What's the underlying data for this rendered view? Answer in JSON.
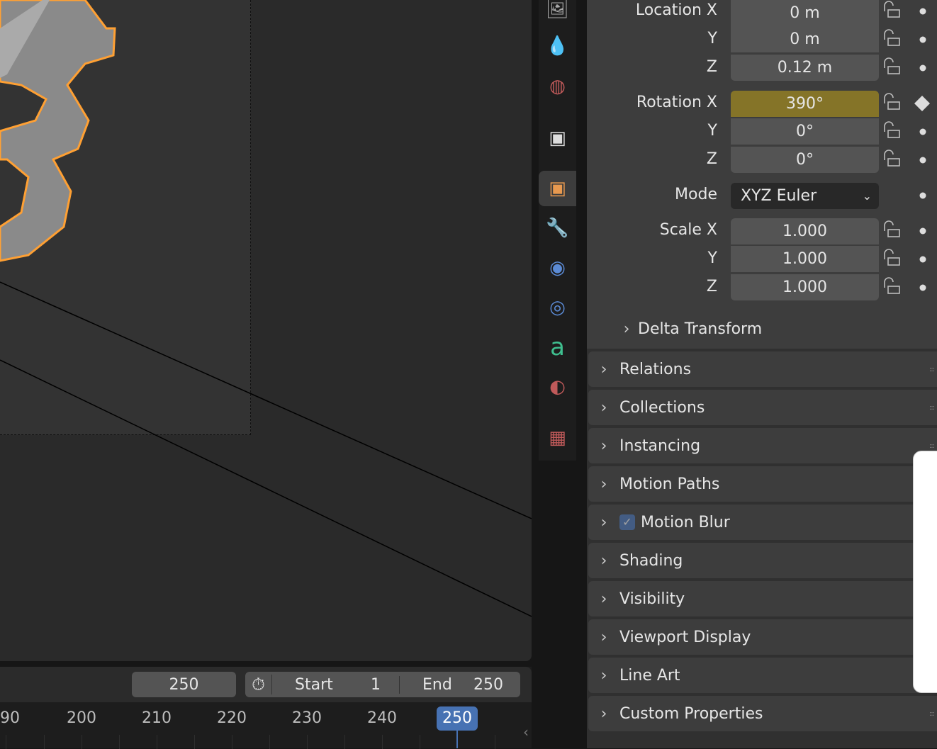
{
  "viewport": {
    "objects": "selected mesh"
  },
  "timeline": {
    "current_frame_field": "250",
    "start_label": "Start",
    "start_value": "1",
    "end_label": "End",
    "end_value": "250",
    "ticks": [
      "90",
      "200",
      "210",
      "220",
      "230",
      "240"
    ],
    "current_frame": "250",
    "stopwatch_icon": "stopwatch-icon"
  },
  "tabs": [
    "render-result-icon",
    "physics-particles-icon",
    "world-icon",
    "collection-icon",
    "object-icon",
    "modifier-icon",
    "particles-icon",
    "physics-icon",
    "constraints-icon",
    "data-text-icon",
    "material-icon",
    "texture-icon"
  ],
  "transform": {
    "location_label": "Location X",
    "loc_x": "0 m",
    "y_label": "Y",
    "loc_y": "0 m",
    "z_label": "Z",
    "loc_z": "0.12 m",
    "rotation_label": "Rotation X",
    "rot_x": "390°",
    "rot_y": "0°",
    "rot_z": "0°",
    "mode_label": "Mode",
    "mode_value": "XYZ Euler",
    "scale_label": "Scale X",
    "scale_x": "1.000",
    "scale_y": "1.000",
    "scale_z": "1.000",
    "delta": "Delta Transform"
  },
  "panels": [
    "Relations",
    "Collections",
    "Instancing",
    "Motion Paths",
    "Motion Blur",
    "Shading",
    "Visibility",
    "Viewport Display",
    "Line Art",
    "Custom Properties"
  ],
  "colors": {
    "keyframed": "#857428",
    "accent": "#4772b3",
    "selection": "#ffa033"
  }
}
